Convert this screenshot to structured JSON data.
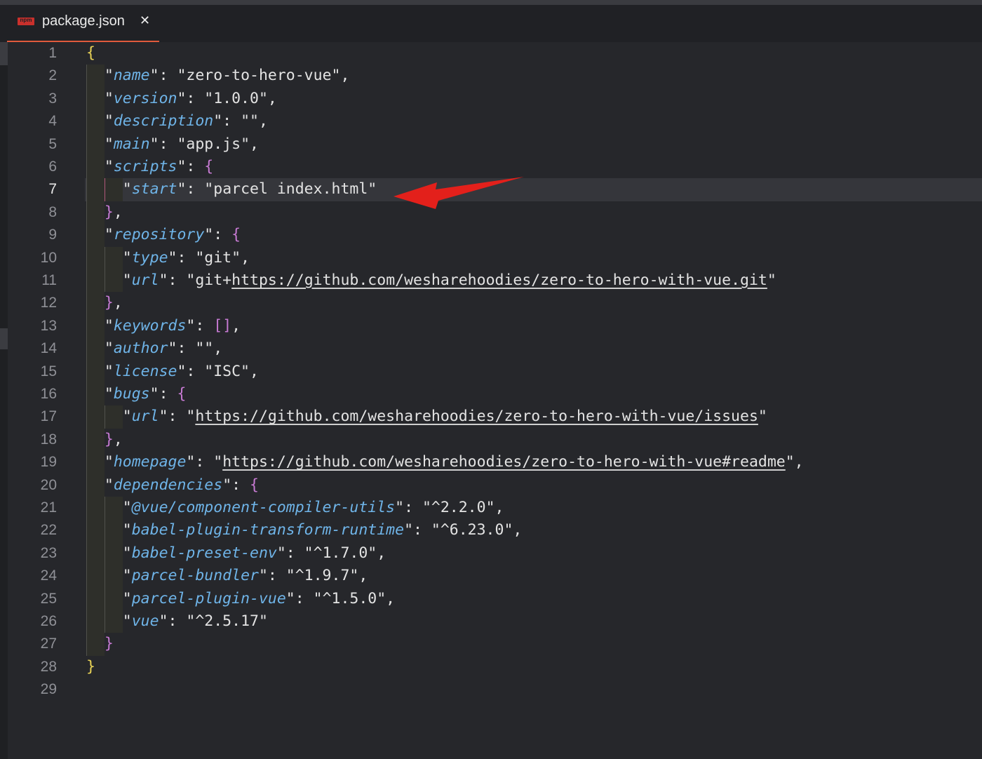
{
  "tab": {
    "title": "package.json",
    "icon": "npm-icon",
    "icon_text": "npm",
    "close_glyph": "✕"
  },
  "editor": {
    "active_line": 7,
    "line_numbers": [
      "1",
      "2",
      "3",
      "4",
      "5",
      "6",
      "7",
      "8",
      "9",
      "10",
      "11",
      "12",
      "13",
      "14",
      "15",
      "16",
      "17",
      "18",
      "19",
      "20",
      "21",
      "22",
      "23",
      "24",
      "25",
      "26",
      "27",
      "28",
      "29"
    ],
    "lines": [
      [
        {
          "t": "{",
          "c": "brace"
        }
      ],
      [
        {
          "t": "  \""
        },
        {
          "t": "name",
          "c": "key"
        },
        {
          "t": "\": \"zero-to-hero-vue\","
        }
      ],
      [
        {
          "t": "  \""
        },
        {
          "t": "version",
          "c": "key"
        },
        {
          "t": "\": \"1.0.0\","
        }
      ],
      [
        {
          "t": "  \""
        },
        {
          "t": "description",
          "c": "key"
        },
        {
          "t": "\": \"\","
        }
      ],
      [
        {
          "t": "  \""
        },
        {
          "t": "main",
          "c": "key"
        },
        {
          "t": "\": \"app.js\","
        }
      ],
      [
        {
          "t": "  \""
        },
        {
          "t": "scripts",
          "c": "key"
        },
        {
          "t": "\": "
        },
        {
          "t": "{",
          "c": "brace2"
        }
      ],
      [
        {
          "t": "    \""
        },
        {
          "t": "start",
          "c": "key"
        },
        {
          "t": "\": \"parcel index.html\""
        }
      ],
      [
        {
          "t": "  "
        },
        {
          "t": "}",
          "c": "brace2"
        },
        {
          "t": ","
        }
      ],
      [
        {
          "t": "  \""
        },
        {
          "t": "repository",
          "c": "key"
        },
        {
          "t": "\": "
        },
        {
          "t": "{",
          "c": "brace2"
        }
      ],
      [
        {
          "t": "    \""
        },
        {
          "t": "type",
          "c": "key"
        },
        {
          "t": "\": \"git\","
        }
      ],
      [
        {
          "t": "    \""
        },
        {
          "t": "url",
          "c": "key"
        },
        {
          "t": "\": \"git+"
        },
        {
          "t": "https://github.com/wesharehoodies/zero-to-hero-with-vue.git",
          "c": "link"
        },
        {
          "t": "\""
        }
      ],
      [
        {
          "t": "  "
        },
        {
          "t": "}",
          "c": "brace2"
        },
        {
          "t": ","
        }
      ],
      [
        {
          "t": "  \""
        },
        {
          "t": "keywords",
          "c": "key"
        },
        {
          "t": "\": "
        },
        {
          "t": "[]",
          "c": "brace2"
        },
        {
          "t": ","
        }
      ],
      [
        {
          "t": "  \""
        },
        {
          "t": "author",
          "c": "key"
        },
        {
          "t": "\": \"\","
        }
      ],
      [
        {
          "t": "  \""
        },
        {
          "t": "license",
          "c": "key"
        },
        {
          "t": "\": \"ISC\","
        }
      ],
      [
        {
          "t": "  \""
        },
        {
          "t": "bugs",
          "c": "key"
        },
        {
          "t": "\": "
        },
        {
          "t": "{",
          "c": "brace2"
        }
      ],
      [
        {
          "t": "    \""
        },
        {
          "t": "url",
          "c": "key"
        },
        {
          "t": "\": \""
        },
        {
          "t": "https://github.com/wesharehoodies/zero-to-hero-with-vue/issues",
          "c": "link"
        },
        {
          "t": "\""
        }
      ],
      [
        {
          "t": "  "
        },
        {
          "t": "}",
          "c": "brace2"
        },
        {
          "t": ","
        }
      ],
      [
        {
          "t": "  \""
        },
        {
          "t": "homepage",
          "c": "key"
        },
        {
          "t": "\": \""
        },
        {
          "t": "https://github.com/wesharehoodies/zero-to-hero-with-vue#readme",
          "c": "link"
        },
        {
          "t": "\","
        }
      ],
      [
        {
          "t": "  \""
        },
        {
          "t": "dependencies",
          "c": "key"
        },
        {
          "t": "\": "
        },
        {
          "t": "{",
          "c": "brace2"
        }
      ],
      [
        {
          "t": "    \""
        },
        {
          "t": "@vue/component-compiler-utils",
          "c": "key"
        },
        {
          "t": "\": \"^2.2.0\","
        }
      ],
      [
        {
          "t": "    \""
        },
        {
          "t": "babel-plugin-transform-runtime",
          "c": "key"
        },
        {
          "t": "\": \"^6.23.0\","
        }
      ],
      [
        {
          "t": "    \""
        },
        {
          "t": "babel-preset-env",
          "c": "key"
        },
        {
          "t": "\": \"^1.7.0\","
        }
      ],
      [
        {
          "t": "    \""
        },
        {
          "t": "parcel-bundler",
          "c": "key"
        },
        {
          "t": "\": \"^1.9.7\","
        }
      ],
      [
        {
          "t": "    \""
        },
        {
          "t": "parcel-plugin-vue",
          "c": "key"
        },
        {
          "t": "\": \"^1.5.0\","
        }
      ],
      [
        {
          "t": "    \""
        },
        {
          "t": "vue",
          "c": "key"
        },
        {
          "t": "\": \"^2.5.17\""
        }
      ],
      [
        {
          "t": "  "
        },
        {
          "t": "}",
          "c": "brace2"
        }
      ],
      [
        {
          "t": "}",
          "c": "brace"
        }
      ],
      [
        {
          "t": ""
        }
      ]
    ]
  },
  "colors": {
    "background": "#26272b",
    "key": "#6fb4e8",
    "outer_brace": "#e8d256",
    "inner_brace": "#c77ad3",
    "arrow": "#e3201b",
    "tab_underline": "#e05a3c"
  },
  "annotation": {
    "type": "red-arrow",
    "points_to_line": 7
  }
}
